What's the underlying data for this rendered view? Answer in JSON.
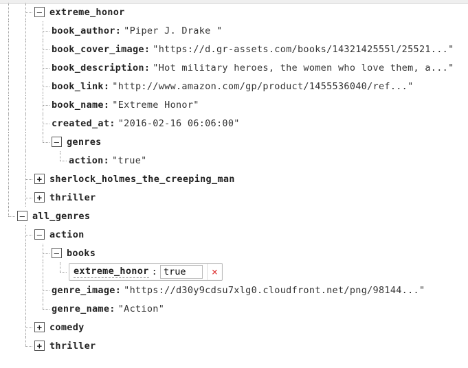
{
  "tree": {
    "extreme_honor": {
      "label": "extreme_honor",
      "fields": {
        "book_author": "\"Piper J. Drake \"",
        "book_cover_image": "\"https://d.gr-assets.com/books/1432142555l/25521...\"",
        "book_description": "\"Hot military heroes, the women who love them, a...\"",
        "book_link": "\"http://www.amazon.com/gp/product/1455536040/ref...\"",
        "book_name": "\"Extreme Honor\"",
        "created_at": "\"2016-02-16 06:06:00\""
      },
      "genres": {
        "label": "genres",
        "action": {
          "key": "action",
          "value": "\"true\""
        }
      }
    },
    "siblings_after_extreme_honor": [
      "sherlock_holmes_the_creeping_man",
      "thriller"
    ],
    "all_genres": {
      "label": "all_genres",
      "action": {
        "label": "action",
        "books": {
          "label": "books",
          "edit": {
            "key": "extreme_honor",
            "value": "true"
          }
        },
        "genre_image": {
          "key": "genre_image",
          "value": "\"https://d30y9cdsu7xlg0.cloudfront.net/png/98144...\""
        },
        "genre_name": {
          "key": "genre_name",
          "value": "\"Action\""
        }
      },
      "collapsed": [
        "comedy",
        "thriller"
      ]
    }
  },
  "icons": {
    "delete_title": "Remove"
  }
}
